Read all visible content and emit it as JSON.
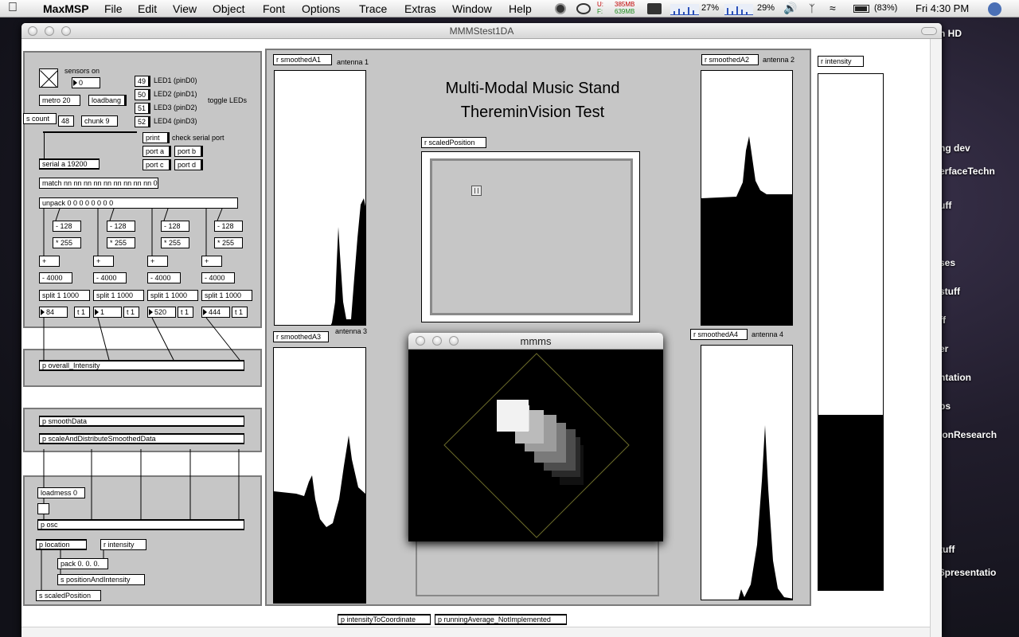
{
  "menubar": {
    "apple": "",
    "items": [
      "MaxMSP",
      "File",
      "Edit",
      "View",
      "Object",
      "Font",
      "Options",
      "Trace",
      "Extras",
      "Window",
      "Help"
    ],
    "mem_u_label": "U:",
    "mem_f_label": "F:",
    "mem_used": "385MB",
    "mem_free": "639MB",
    "cpu1": "27%",
    "cpu2": "29%",
    "battery": "(83%)",
    "clock": "Fri 4:30 PM"
  },
  "desktop_items": [
    "n HD",
    "ng dev",
    "erfaceTechn",
    "uff",
    "ses",
    "stuff",
    "ff",
    "er",
    "ntation",
    "ps",
    "ionResearch",
    "tuff",
    "6presentatio"
  ],
  "window": {
    "title": "MMMStest1DA"
  },
  "leftpanel": {
    "sensors_on": "sensors on",
    "num0": "0",
    "metro": "metro 20",
    "loadbang": "loadbang",
    "scount": "s count",
    "num48": "48",
    "chunk": "chunk 9",
    "leds": [
      {
        "val": "49",
        "label": "LED1 (pinD0)"
      },
      {
        "val": "50",
        "label": "LED2 (pinD1)"
      },
      {
        "val": "51",
        "label": "LED3 (pinD2)"
      },
      {
        "val": "52",
        "label": "LED4 (pinD3)"
      }
    ],
    "toggle_leds": "toggle LEDs",
    "print": "print",
    "check_serial": "check serial port",
    "port_a": "port a",
    "port_b": "port b",
    "port_c": "port c",
    "port_d": "port d",
    "serial": "serial a 19200",
    "match": "match nn nn nn nn nn nn nn nn nn 0",
    "unpack": "unpack 0 0 0 0 0 0 0 0",
    "columns": [
      {
        "sub": "- 128",
        "mul": "* 255",
        "plus": "+",
        "sub2": "- 4000",
        "split": "split 1 1000",
        "num": "84",
        "t": "t 1"
      },
      {
        "sub": "- 128",
        "mul": "* 255",
        "plus": "+",
        "sub2": "- 4000",
        "split": "split 1 1000",
        "num": "1",
        "t": "t 1"
      },
      {
        "sub": "- 128",
        "mul": "* 255",
        "plus": "+",
        "sub2": "- 4000",
        "split": "split 1 1000",
        "num": "520",
        "t": "t 1"
      },
      {
        "sub": "- 128",
        "mul": "* 255",
        "plus": "+",
        "sub2": "- 4000",
        "split": "split 1 1000",
        "num": "444",
        "t": "t 1"
      }
    ],
    "overall": "p overall_Intensity",
    "smooth": "p smoothData",
    "scale_dist": "p scaleAndDistributeSmoothedData",
    "loadmess": "loadmess 0",
    "posc": "p osc",
    "location": "p location",
    "rintensity": "r intensity",
    "pack": "pack 0. 0. 0.",
    "spos": "s positionAndIntensity",
    "sscaled": "s scaledPosition"
  },
  "main": {
    "title_line1": "Multi-Modal Music Stand",
    "title_line2": "ThereminVision Test",
    "scaled_position": "r scaledPosition",
    "antennas": [
      {
        "recv": "r smoothedA1",
        "label": "antenna 1"
      },
      {
        "recv": "r smoothedA2",
        "label": "antenna 2"
      },
      {
        "recv": "r smoothedA3",
        "label": "antenna 3"
      },
      {
        "recv": "r smoothedA4",
        "label": "antenna 4"
      }
    ],
    "r_intensity": "r intensity",
    "intensity_level": 0.34,
    "bottom_obj1": "p intensityToCoordinate",
    "bottom_obj2": "p runningAverage_NotImplemented"
  },
  "mmms": {
    "title": "mmms"
  }
}
